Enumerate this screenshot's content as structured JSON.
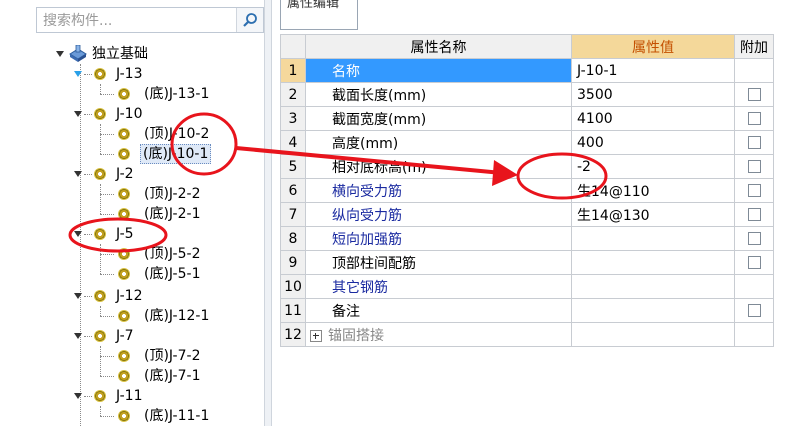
{
  "search": {
    "placeholder": "搜索构件..."
  },
  "tree": {
    "root": {
      "label": "独立基础"
    },
    "groups": [
      {
        "label": "J-13",
        "children": [
          "(底)J-13-1"
        ]
      },
      {
        "label": "J-10",
        "children": [
          "(顶)J-10-2",
          "(底)J-10-1"
        ]
      },
      {
        "label": "J-2",
        "children": [
          "(顶)J-2-2",
          "(底)J-2-1"
        ]
      },
      {
        "label": "J-5",
        "children": [
          "(顶)J-5-2",
          "(底)J-5-1"
        ]
      },
      {
        "label": "J-12",
        "children": [
          "(底)J-12-1"
        ]
      },
      {
        "label": "J-7",
        "children": [
          "(顶)J-7-2",
          "(底)J-7-1"
        ]
      },
      {
        "label": "J-11",
        "children": [
          "(底)J-11-1"
        ]
      }
    ]
  },
  "tab": {
    "label": "属性编辑"
  },
  "grid": {
    "headers": {
      "name": "属性名称",
      "value": "属性值",
      "add": "附加"
    },
    "rows": [
      {
        "num": "1",
        "name": "名称",
        "value": "J-10-1",
        "checkbox": false
      },
      {
        "num": "2",
        "name": "截面长度(mm)",
        "value": "3500",
        "checkbox": true
      },
      {
        "num": "3",
        "name": "截面宽度(mm)",
        "value": "4100",
        "checkbox": true
      },
      {
        "num": "4",
        "name": "高度(mm)",
        "value": "400",
        "checkbox": true
      },
      {
        "num": "5",
        "name": "相对底标高(m)",
        "value": "-2",
        "checkbox": true
      },
      {
        "num": "6",
        "name": "横向受力筋",
        "value": "生14@110",
        "checkbox": true
      },
      {
        "num": "7",
        "name": "纵向受力筋",
        "value": "生14@130",
        "checkbox": true
      },
      {
        "num": "8",
        "name": "短向加强筋",
        "value": "",
        "checkbox": true
      },
      {
        "num": "9",
        "name": "顶部柱间配筋",
        "value": "",
        "checkbox": true
      },
      {
        "num": "10",
        "name": "其它钢筋",
        "value": "",
        "checkbox": false
      },
      {
        "num": "11",
        "name": "备注",
        "value": "",
        "checkbox": true
      },
      {
        "num": "12",
        "name": "锚固搭接",
        "value": "",
        "checkbox": false
      }
    ]
  },
  "colors": {
    "annotation": "#e8141c",
    "selection": "#3399ff",
    "header_value": "#c45000"
  }
}
